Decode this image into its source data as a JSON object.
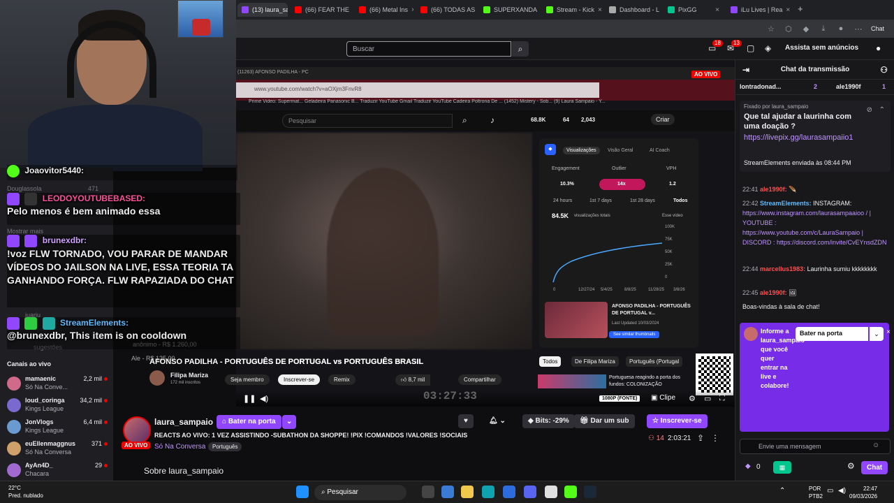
{
  "browser": {
    "tabs": [
      {
        "label": "(13) laura_sam",
        "color": "#9147ff",
        "active": true
      },
      {
        "label": "(66) FEAR THE",
        "color": "#ff0000"
      },
      {
        "label": "(66) Metal Ins",
        "color": "#ff0000"
      },
      {
        "label": "(66) TODAS AS",
        "color": "#ff0000"
      },
      {
        "label": "SUPERXANDA",
        "color": "#53fc18"
      },
      {
        "label": "Stream - Kick",
        "color": "#53fc18"
      },
      {
        "label": "Dashboard - L",
        "color": "#aaaaaa"
      },
      {
        "label": "PixGG",
        "color": "#00c58e"
      },
      {
        "label": "iLu Lives | Rea",
        "color": "#9147ff"
      }
    ],
    "new_tab": "+",
    "chat_label": "Chat"
  },
  "twitch": {
    "search_placeholder": "Buscar",
    "notif_a": "18",
    "notif_b": "13",
    "assist": "Assista sem anúncios"
  },
  "overlay": [
    {
      "user": "Joaovitor5440:",
      "msg": "",
      "color": "#00b7ff"
    },
    {
      "user": "LEODOYOUTUBEBASED:",
      "msg": "Pelo menos é bem animado essa",
      "color": "#ff4f9a"
    },
    {
      "user": "brunexdbr:",
      "msg": "!voz FLW TORNADO, VOU PARAR DE MANDAR VÍDEOS DO JAILSON NA LIVE, ESSA TEORIA TA GANHANDO FORÇA. FLW RAPAZIADA DO CHAT",
      "color": "#cfa2ff"
    },
    {
      "user": "StreamElements:",
      "msg": "@brunexdbr, This item is on cooldown",
      "color": "#5bbcff"
    }
  ],
  "sidebar": {
    "ghost": [
      "Douglassola",
      "Mostrar mais",
      "sugestões",
      "juariu",
      "anônimo - R$ 1.260,00",
      "Ale - R$ 125,00"
    ],
    "ghost_views": "471",
    "title": "Canais ao vivo",
    "channels": [
      {
        "name": "mamaenic",
        "game": "Só Na Conve...",
        "viewers": "2,2 mil",
        "color": "#d06a8a"
      },
      {
        "name": "loud_coringa",
        "game": "Kings League",
        "viewers": "34,2 mil",
        "color": "#7a6ad0"
      },
      {
        "name": "JonVlogs",
        "game": "Kings League",
        "viewers": "6,4 mil",
        "color": "#6a9ad0"
      },
      {
        "name": "euEllenmaggnus",
        "game": "Só Na Conversa",
        "viewers": "371",
        "color": "#d0a06a"
      },
      {
        "name": "AyAn4D_",
        "game": "Chacara",
        "viewers": "29",
        "color": "#a06ad0"
      }
    ]
  },
  "video": {
    "inner_url": "www.youtube.com/watch?v=aOXjm3FnvR8",
    "inner_tab": "(11263) AFONSO PADILHA - PC",
    "live_badge": "AO VIVO",
    "bookmarks": "Prime Video: Supermat...   Geladeira Panasonic B...   Traduzir   YouTube   Gmail   Traduzir   YouTube   Cadeira Poltrona De ...   (1452) Mistery - Sob...   (9) Laura Sampaio - Y...",
    "yt_search": "Pesquisar",
    "yt_stats": [
      "68.8K",
      "64",
      "2,043"
    ],
    "yt_create": "Criar",
    "analytics": {
      "tabs": [
        "Visualizações",
        "Visão Geral",
        "AI Coach"
      ],
      "heads": [
        "Engagement",
        "Outlier",
        "VPH"
      ],
      "vals": [
        "10.3%",
        "14x",
        "1.2"
      ],
      "ranges": [
        "24 hours",
        "1st 7 days",
        "1st 28 days",
        "Todos"
      ],
      "total": "84.5K",
      "total_label": "visualizações totais",
      "series_label": "Esse vídeo",
      "yticks": [
        "100K",
        "75K",
        "50K",
        "25K",
        "0"
      ],
      "xticks": [
        "0",
        "12/27/24",
        "5/4/25",
        "8/8/25",
        "11/28/25",
        "3/8/26"
      ],
      "thumb_title": "AFONSO PADILHA - PORTUGUÊS DE PORTUGAL v...",
      "thumb_date": "Last Updated 10/03/2024",
      "see_similar": "See similar thumbnails"
    },
    "title": "AFONSO PADILHA - PORTUGUÊS DE PORTUGAL vs PORTUGUÊS BRASIL",
    "channel": "Filipa Mariza",
    "subs": "172 mil inscritos",
    "member": "Seja membro",
    "subscribe": "Inscrever-se",
    "remix": "Remix",
    "likes": "8,7 mil",
    "share": "Compartilhar",
    "chips": [
      "Todos",
      "De Filipa Mariza",
      "Português (Portugal"
    ],
    "related": "Portuguesa reagindo a porta dos fundos: COLONIZAÇÃO",
    "timer": "03:27:33",
    "quality": "1080P (FONTE)",
    "clip": "Clipe"
  },
  "stream": {
    "channel": "laura_sampaio",
    "knock": "Bater na porta",
    "live": "AO VIVO",
    "title": "REACTS AO VIVO: 1 VEZ ASSISTINDO -SUBATHON DA SHOPPE! !PIX !COMANDOS !VALORES !SOCIAIS",
    "game": "Só Na Conversa",
    "tag": "Português",
    "bits": "Bits: -29%",
    "sub": "Dar um sub",
    "follow": "Inscrever-se",
    "viewers": "14",
    "uptime": "2:03:21",
    "about": "Sobre laura_sampaio"
  },
  "chat": {
    "header": "Chat da transmissão",
    "subs": [
      {
        "user": "lontradonad...",
        "n": "2"
      },
      {
        "user": "ale1990f",
        "n": "1"
      }
    ],
    "pinned_by": "Fixado por laura_sampaio",
    "pinned_text": "Que tal ajudar a laurinha com uma doação ?",
    "pinned_link": "https://livepix.gg/laurasampaiio1",
    "pinned_sent": "StreamElements enviada às 08:44 PM",
    "messages": [
      {
        "t": "22:41",
        "user": "ale1990f:",
        "color": "#ff4f4f",
        "text": ""
      },
      {
        "t": "22:42",
        "user": "StreamElements:",
        "color": "#5bbcff",
        "text": "INSTAGRAM: ",
        "link": "https://www.instagram.com/laurasampaaioo / | YOUTUBE : https://www.youtube.com/c/LauraSampaio | DISCORD : https://discord.com/invite/CvEYnsdZDN"
      },
      {
        "t": "22:44",
        "user": "marcellus1983:",
        "color": "#ff4f4f",
        "text": "Laurinha sumiu kkkkkkkk"
      },
      {
        "t": "22:45",
        "user": "ale1990f:",
        "color": "#ff4f4f",
        "text": ""
      }
    ],
    "welcome": "Boas-vindas à sala de chat!",
    "door_text": "Informe a laura_sampaio que você quer entrar na live e colabore!",
    "door_btn": "Bater na porta",
    "placeholder": "Envie uma mensagem",
    "points": "0",
    "send": "Chat"
  },
  "taskbar": {
    "temp": "22°C",
    "weather": "Pred. nublado",
    "search": "Pesquisar",
    "lang1": "POR",
    "lang2": "PTB2",
    "time": "22:47",
    "date": "09/03/2026"
  }
}
